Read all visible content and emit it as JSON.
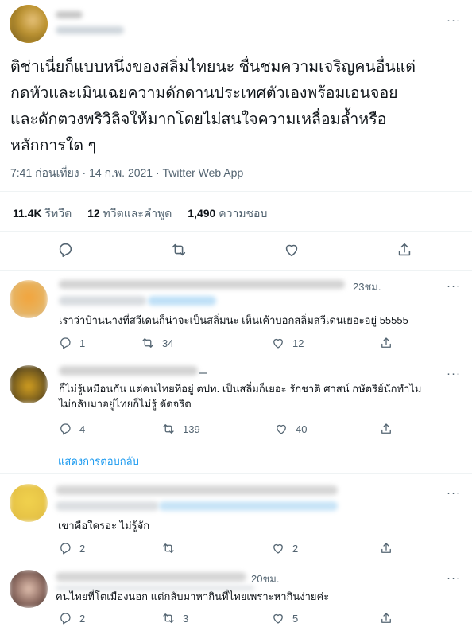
{
  "tweet": {
    "text_lines": [
      "ติช่าเนี่ยก็แบบหนึ่งของสลิ่มไทยนะ ชื่นชมความเจริญคนอื่นแต่",
      "กดหัวและเมินเฉยความดักดานประเทศตัวเองพร้อมเอนจอย",
      "และดักตวงพริวิลิจให้มากโดยไม่สนใจความเหลื่อมล้ำหรือ",
      "หลักการใด ๆ"
    ],
    "time": "7:41 ก่อนเที่ยง",
    "date": "14 ก.พ. 2021",
    "source": "Twitter Web App",
    "separator": "·",
    "stats": {
      "retweets_count": "11.4K",
      "retweets_label": "รีทวีต",
      "quotes_count": "12",
      "quotes_label": "ทวีตและคำพูด",
      "likes_count": "1,490",
      "likes_label": "ความชอบ"
    }
  },
  "more_glyph": "···",
  "replies": [
    {
      "time": "23ชม.",
      "text_lines": [
        "เราว่าบ้านนางที่สวีเดนก็น่าจะเป็นสลิ่มนะ เห็นเค้าบอกสลิ่มสวีเดนเยอะอยู่ 55555"
      ],
      "reply_count": "1",
      "retweet_count": "34",
      "like_count": "12"
    },
    {
      "time": "",
      "text_lines": [
        "ก็ไม่รู้เหมือนกัน แต่คนไทยที่อยู่ ตปท. เป็นสลิ่มก็เยอะ รักชาติ ศาสน์ กษัตริย์นักทำไม",
        "ไม่กลับมาอยู่ไทยก็ไม่รู้ ดัดจริต"
      ],
      "reply_count": "4",
      "retweet_count": "139",
      "like_count": "40"
    },
    {
      "time": "",
      "text_lines": [
        "เขาคือใครอ่ะ ไม่รู้จัก"
      ],
      "reply_count": "2",
      "retweet_count": "",
      "like_count": "2"
    },
    {
      "time": "20ชม.",
      "text_lines": [
        "คนไทยที่โตเมืองนอก แต่กลับมาหากินที่ไทยเพราะหากินง่ายค่ะ"
      ],
      "reply_count": "2",
      "retweet_count": "3",
      "like_count": "5"
    }
  ],
  "show_replies_label": "แสดงการตอบกลับ",
  "colors": {
    "accent": "#1d9bf0",
    "secondary_text": "#536471",
    "divider": "#eff3f4"
  },
  "icons": [
    "more-icon",
    "reply-icon",
    "retweet-icon",
    "like-icon",
    "share-icon"
  ]
}
